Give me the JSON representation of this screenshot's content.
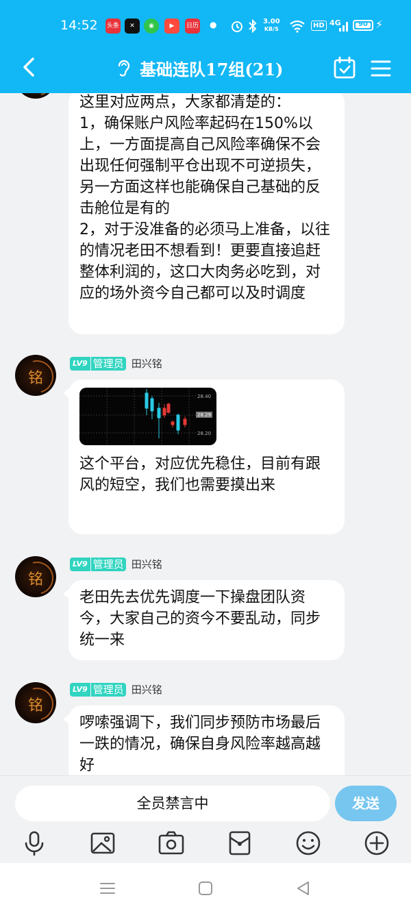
{
  "status_bar": {
    "time": "14:52",
    "app_icons": [
      {
        "label": "头条",
        "color": "#e8333b"
      },
      {
        "label": "✕",
        "color": "#111111"
      },
      {
        "label": "◉",
        "color": "#2fc54a"
      },
      {
        "label": "▶",
        "color": "#ff4a3d"
      },
      {
        "label": "日历",
        "color": "#e8333b"
      }
    ],
    "net_speed_value": "3.00",
    "net_speed_unit": "KB/S",
    "hd": "HD",
    "signal_type": "4G",
    "battery": "90"
  },
  "header": {
    "title": "基础连队17组(21)"
  },
  "messages": [
    {
      "text": "这里对应两点，大家都清楚的：\n1，确保账户风险率起码在150%以上，一方面提高自己风险率确保不会出现任何强制平仓出现不可逆损失，另一方面这样也能确保自己基础的反击舱位是有的\n2，对于没准备的必须马上准备，以往的情况老田不想看到！更要直接追赶整体利润的，这口大肉务必吃到，对应的场外资今自己都可以及时调度"
    },
    {
      "level": "LV9",
      "role": "管理员",
      "sender": "田兴铭",
      "image": {
        "price_labels": [
          "28.40",
          "28.29",
          "28.20"
        ]
      },
      "text": "这个平台，对应优先稳住，目前有跟风的短空，我们也需要摸出来"
    },
    {
      "level": "LV9",
      "role": "管理员",
      "sender": "田兴铭",
      "text": "老田先去优先调度一下操盘团队资今，大家自己的资今不要乱动，同步统一来"
    },
    {
      "level": "LV9",
      "role": "管理员",
      "sender": "田兴铭",
      "text": "啰嗦强调下，我们同步预防市场最后一跌的情况，确保自身风险率越高越好"
    }
  ],
  "avatar_glyph": "铭",
  "input": {
    "muted_text": "全员禁言中",
    "send_label": "发送"
  },
  "toolbar": [
    "microphone-icon",
    "image-icon",
    "camera-icon",
    "red-packet-icon",
    "emoji-icon",
    "plus-icon"
  ],
  "colors": {
    "header": "#12b7f5",
    "badge": "#31d4c0",
    "send": "#76c6f0",
    "background": "#f1f2f4"
  }
}
